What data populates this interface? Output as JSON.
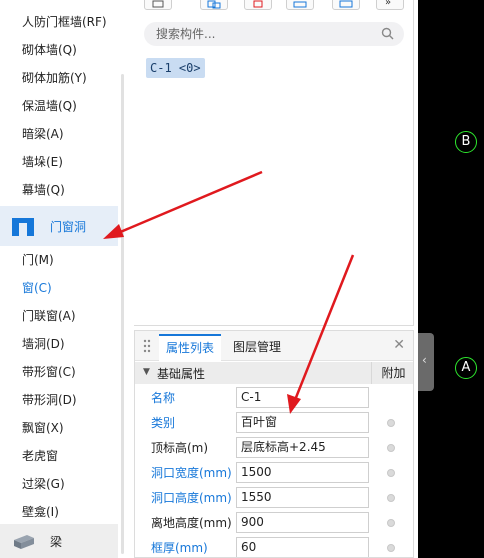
{
  "tree": {
    "items_top": [
      {
        "label": "人防门框墙(RF)"
      },
      {
        "label": "砌体墙(Q)"
      },
      {
        "label": "砌体加筋(Y)"
      },
      {
        "label": "保温墙(Q)"
      },
      {
        "label": "暗梁(A)"
      },
      {
        "label": "墙垛(E)"
      },
      {
        "label": "幕墙(Q)"
      }
    ],
    "group_door": {
      "label": "门窗洞",
      "icon": "door-window-icon"
    },
    "items_door": [
      {
        "label": "门(M)"
      },
      {
        "label": "窗(C)"
      },
      {
        "label": "门联窗(A)"
      },
      {
        "label": "墙洞(D)"
      },
      {
        "label": "带形窗(C)"
      },
      {
        "label": "带形洞(D)"
      },
      {
        "label": "飘窗(X)"
      },
      {
        "label": "老虎窗"
      },
      {
        "label": "过梁(G)"
      },
      {
        "label": "壁龛(I)"
      }
    ],
    "group_beam": {
      "label": "梁",
      "icon": "beam-icon"
    },
    "selected_label": "窗(C)"
  },
  "component_list": {
    "search_placeholder": "搜索构件...",
    "items": [
      {
        "label": "C-1 <0>"
      }
    ]
  },
  "properties": {
    "tabs": [
      {
        "label": "属性列表"
      },
      {
        "label": "图层管理"
      }
    ],
    "section_title": "基础属性",
    "extra_col": "附加",
    "rows": [
      {
        "name": "名称",
        "value": "C-1"
      },
      {
        "name": "类别",
        "value": "百叶窗"
      },
      {
        "name": "顶标高(m)",
        "value": "层底标高+2.45"
      },
      {
        "name": "洞口宽度(mm)",
        "value": "1500"
      },
      {
        "name": "洞口高度(mm)",
        "value": "1550"
      },
      {
        "name": "离地高度(mm)",
        "value": "900"
      },
      {
        "name": "框厚(mm)",
        "value": "60"
      }
    ]
  },
  "canvas": {
    "axis_markers": [
      {
        "label": "B"
      },
      {
        "label": "A"
      }
    ]
  },
  "colors": {
    "accent": "#1677d9",
    "arrow": "#e0191e",
    "axis_circle": "#2ee82e",
    "canvas_bg": "#000000"
  }
}
